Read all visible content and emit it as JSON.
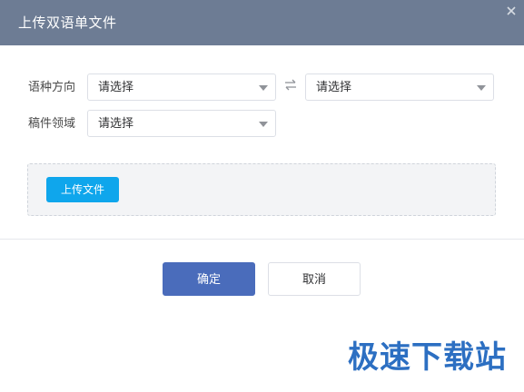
{
  "dialog": {
    "title": "上传双语单文件",
    "close_icon": "close-icon"
  },
  "form": {
    "language_direction": {
      "label": "语种方向",
      "source_value": "请选择",
      "target_value": "请选择",
      "swap_icon": "swap-arrows-icon"
    },
    "domain": {
      "label": "稿件领域",
      "value": "请选择"
    }
  },
  "upload": {
    "button_label": "上传文件"
  },
  "footer": {
    "confirm_label": "确定",
    "cancel_label": "取消"
  },
  "watermark": {
    "text": "极速下载站"
  },
  "colors": {
    "header_bg": "#6d7c94",
    "upload_button": "#0fa6ec",
    "confirm_button": "#4a6cbb",
    "watermark": "#2c6fc2"
  }
}
